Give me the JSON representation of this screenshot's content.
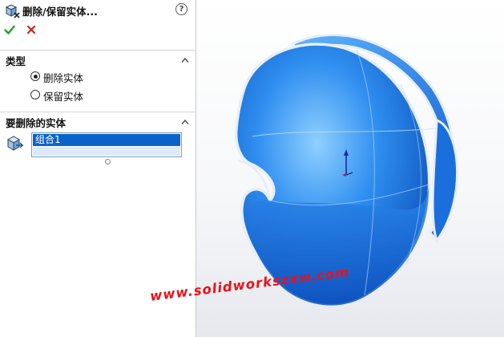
{
  "panel": {
    "title": "删除/保留实体...",
    "help_symbol": "?"
  },
  "sections": {
    "type": {
      "title": "类型",
      "options": [
        {
          "label": "删除实体",
          "checked": true
        },
        {
          "label": "保留实体",
          "checked": false
        }
      ]
    },
    "bodies": {
      "title": "要删除的实体",
      "items": [
        "组合1"
      ]
    }
  },
  "icons": {
    "title": "delete-body-feature-icon",
    "ok": "check-icon",
    "cancel": "close-icon",
    "collapse": "chevron-up-icon",
    "bodies": "solid-body-icon"
  },
  "colors": {
    "ok": "#22a02a",
    "cancel": "#d21f1f",
    "selection": "#0a64c8",
    "model": "#1e78e6",
    "watermark": "#e8121a"
  },
  "watermark": "www.solidworkszxw.com"
}
